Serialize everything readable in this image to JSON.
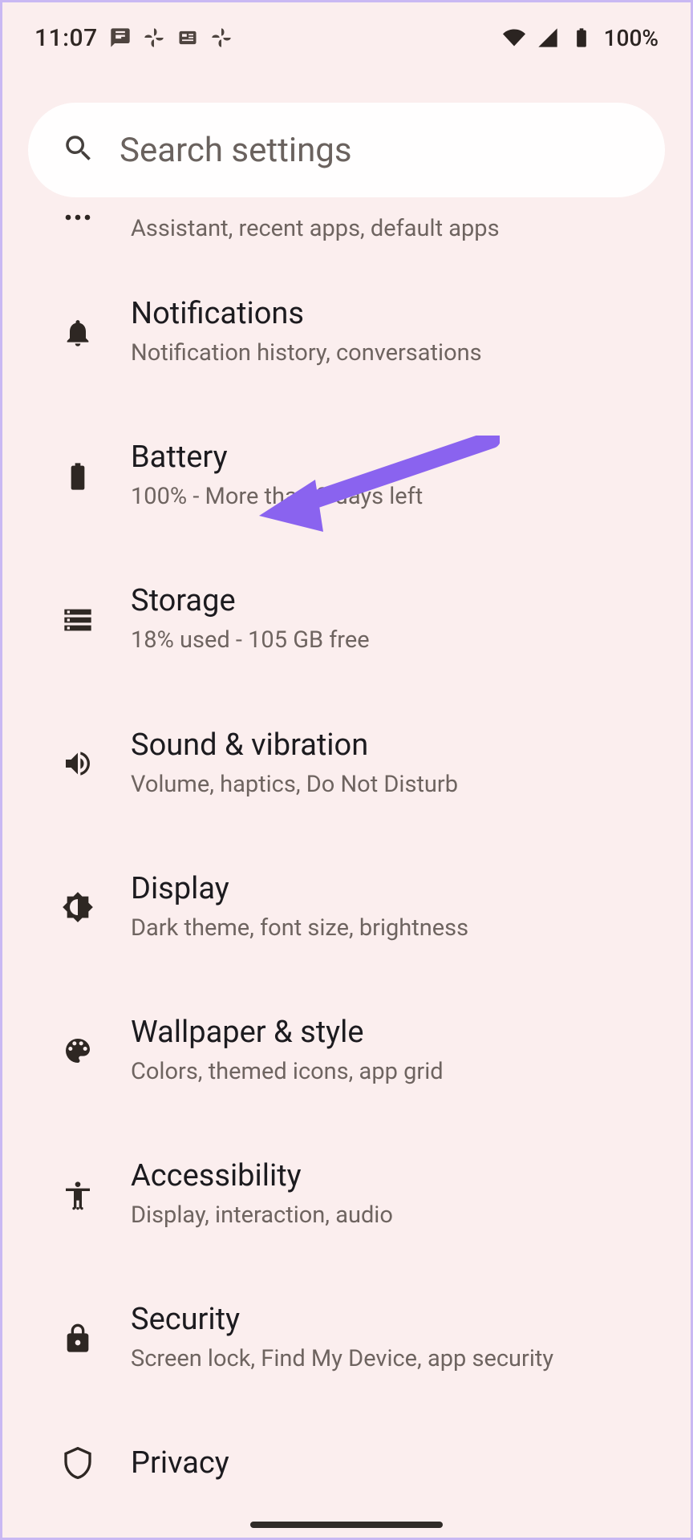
{
  "status_bar": {
    "time": "11:07",
    "battery_percent": "100%"
  },
  "search": {
    "placeholder": "Search settings"
  },
  "annotation": {
    "arrow_color": "#8a63ef",
    "target": "battery-item"
  },
  "items": [
    {
      "id": "apps",
      "title": "",
      "subtitle": "Assistant, recent apps, default apps",
      "icon": "overflow"
    },
    {
      "id": "notifications",
      "title": "Notifications",
      "subtitle": "Notification history, conversations",
      "icon": "bell"
    },
    {
      "id": "battery",
      "title": "Battery",
      "subtitle": "100% - More than 2 days left",
      "icon": "battery"
    },
    {
      "id": "storage",
      "title": "Storage",
      "subtitle": "18% used - 105 GB free",
      "icon": "storage"
    },
    {
      "id": "sound",
      "title": "Sound & vibration",
      "subtitle": "Volume, haptics, Do Not Disturb",
      "icon": "sound"
    },
    {
      "id": "display",
      "title": "Display",
      "subtitle": "Dark theme, font size, brightness",
      "icon": "display"
    },
    {
      "id": "wallpaper",
      "title": "Wallpaper & style",
      "subtitle": "Colors, themed icons, app grid",
      "icon": "palette"
    },
    {
      "id": "accessibility",
      "title": "Accessibility",
      "subtitle": "Display, interaction, audio",
      "icon": "a11y"
    },
    {
      "id": "security",
      "title": "Security",
      "subtitle": "Screen lock, Find My Device, app security",
      "icon": "lock"
    },
    {
      "id": "privacy",
      "title": "Privacy",
      "subtitle": "",
      "icon": "privacy"
    }
  ]
}
